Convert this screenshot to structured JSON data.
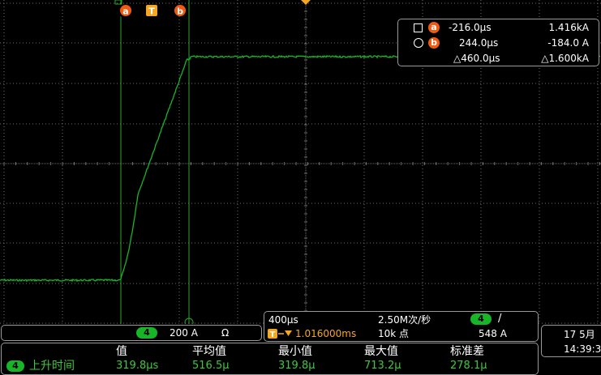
{
  "colors": {
    "trace": "#17b527",
    "grid": "#6e6e6e",
    "cursor_line": "#2ea62e",
    "marker_orange": "#f05a12",
    "trigger_orange": "#f5a623",
    "value_green": "#3cc93c"
  },
  "markers": {
    "cursor_a_label": "a",
    "trigger_label": "T",
    "cursor_b_label": "b"
  },
  "cursor_readout": {
    "a": {
      "label": "a",
      "time": "-216.0µs",
      "value": "1.416kA"
    },
    "b": {
      "label": "b",
      "time": "244.0µs",
      "value": "-184.0 A"
    },
    "delta": {
      "time": "△460.0µs",
      "value": "△1.600kA"
    }
  },
  "waveform": {
    "channel": "4",
    "description_points": [
      [
        0.0,
        -0.0
      ],
      [
        0.0,
        0.0
      ]
    ]
  },
  "channel_bar": {
    "channel": "4",
    "scale": "200 A",
    "coupling": "Ω"
  },
  "timebase": {
    "time_per_div": "400µs",
    "sample_rate": "2.50M次/秒",
    "trigger_channel": "4",
    "trigger_slope": "/",
    "trigger_offset": "1.016000ms",
    "record_length": "10k 点",
    "trigger_level": "548 A"
  },
  "datetime": {
    "date": "17 5月",
    "time": "14:39:3"
  },
  "measurement": {
    "channel": "4",
    "name": "上升时间",
    "headers": [
      "值",
      "平均值",
      "最小值",
      "最大值",
      "标准差"
    ],
    "values": [
      "319.8µs",
      "516.5µ",
      "319.8µ",
      "713.2µ",
      "278.1µ"
    ]
  }
}
